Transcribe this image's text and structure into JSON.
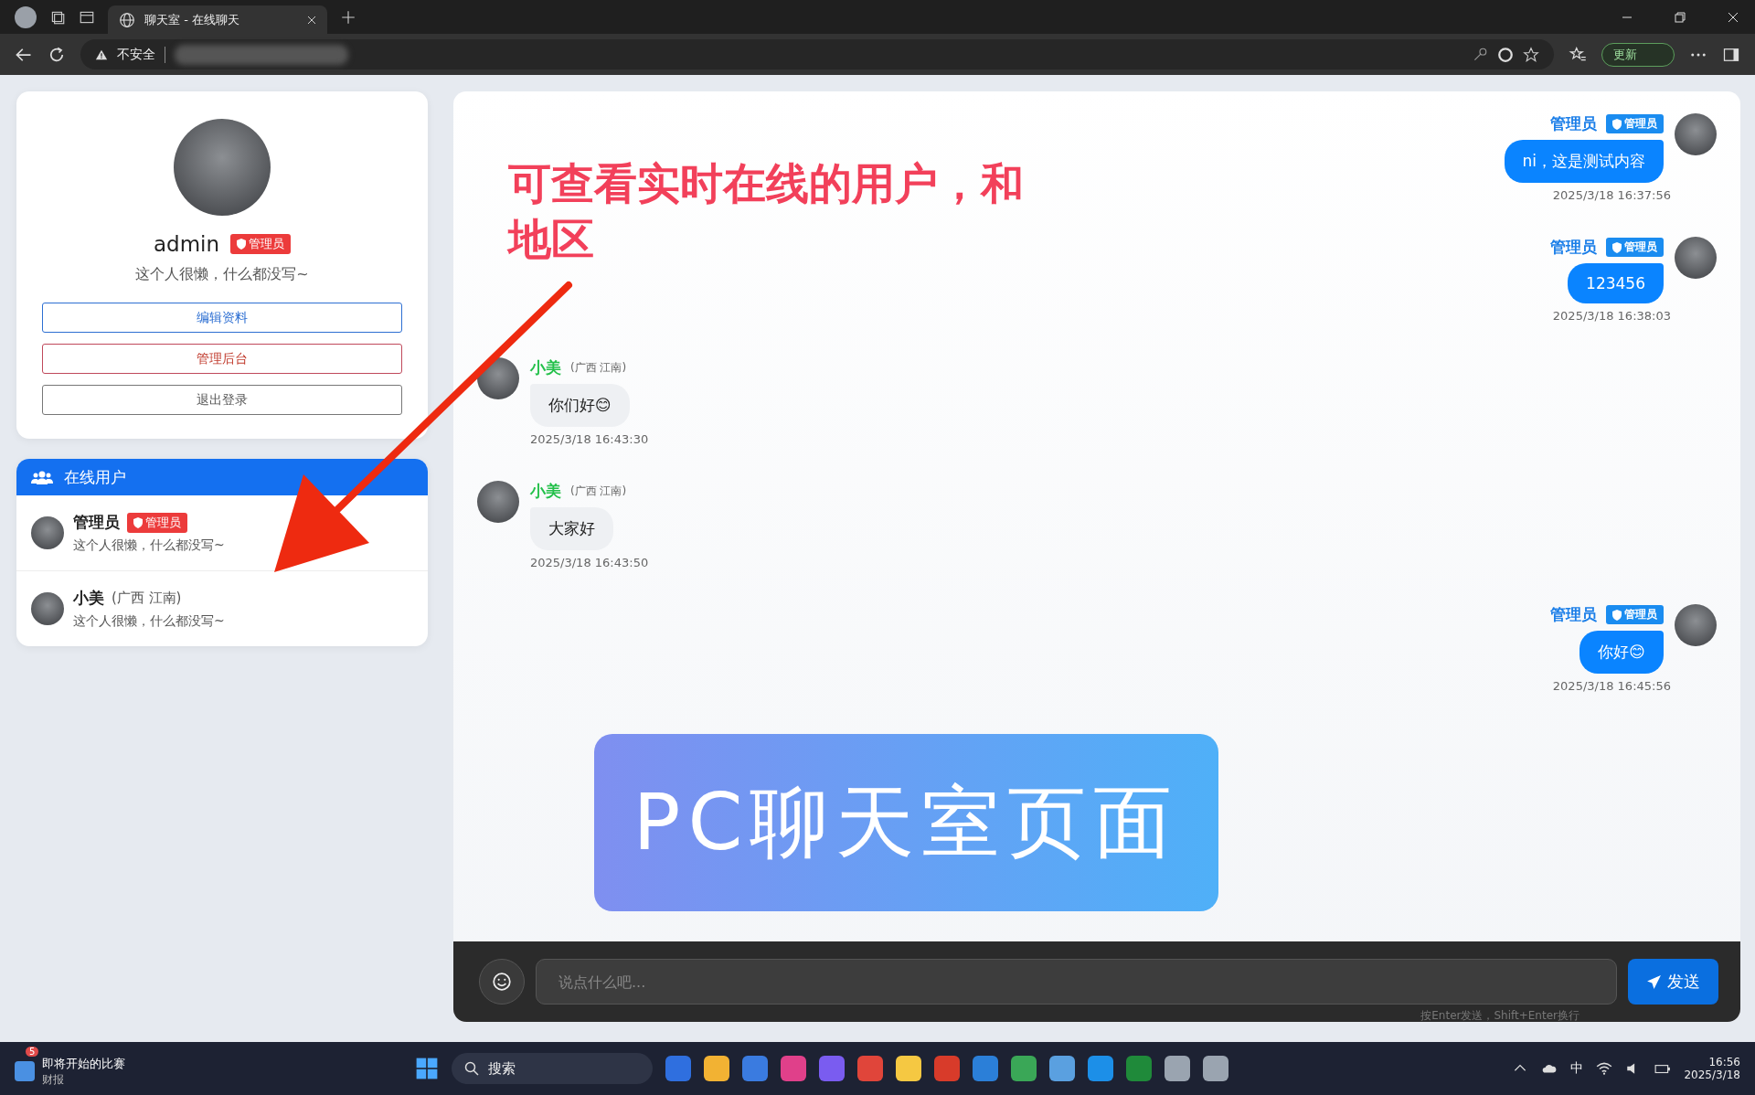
{
  "browser": {
    "tab_title": "聊天室 - 在线聊天",
    "security": "不安全",
    "update_button": "更新"
  },
  "profile": {
    "name": "admin",
    "badge": "管理员",
    "bio": "这个人很懒，什么都没写~",
    "buttons": [
      {
        "label": "编辑资料",
        "kind": "primary"
      },
      {
        "label": "管理后台",
        "kind": "danger"
      },
      {
        "label": "退出登录",
        "kind": "secondary"
      }
    ]
  },
  "online_users": {
    "title": "在线用户",
    "users": [
      {
        "name": "管理员",
        "badge": "管理员",
        "bio": "这个人很懒，什么都没写~"
      },
      {
        "name": "小美",
        "region": "(广西 江南)",
        "bio": "这个人很懒，什么都没写~"
      }
    ]
  },
  "messages": [
    {
      "kind": "self",
      "sender": "管理员",
      "badge": "管理员",
      "text": "ni，这是测试内容",
      "time": "2025/3/18 16:37:56"
    },
    {
      "kind": "self",
      "sender": "管理员",
      "badge": "管理员",
      "text": "123456",
      "time": "2025/3/18 16:38:03"
    },
    {
      "kind": "other",
      "sender": "小美",
      "region": "(广西 江南)",
      "text": "你们好😊",
      "time": "2025/3/18 16:43:30"
    },
    {
      "kind": "other",
      "sender": "小美",
      "region": "(广西 江南)",
      "text": "大家好",
      "time": "2025/3/18 16:43:50"
    },
    {
      "kind": "self",
      "sender": "管理员",
      "badge": "管理员",
      "text": "你好😊",
      "time": "2025/3/18 16:45:56"
    }
  ],
  "composer": {
    "placeholder": "说点什么吧...",
    "send_button": "发送",
    "hint": "按Enter发送，Shift+Enter换行"
  },
  "annotations": {
    "callout": "可查看实时在线的用户，和地区",
    "banner": "PC聊天室页面"
  },
  "taskbar": {
    "news_badge": "5",
    "news_title": "即将开始的比赛",
    "news_sub": "财报",
    "search": "搜索",
    "ime": "中",
    "time": "16:56",
    "date": "2025/3/18"
  }
}
